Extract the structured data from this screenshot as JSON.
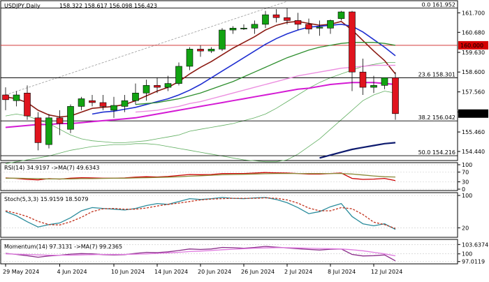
{
  "header": {
    "symbol": "USDJPY,Daily",
    "ohlc": "158.322 158.617 156.098 156.423"
  },
  "colors": {
    "bull": "#12a312",
    "bear": "#e0141e",
    "ma_darkred": "#8b1a12",
    "ma_blue": "#1f2fd1",
    "ma_green": "#2f8f2f",
    "ma_pink": "#ec8fe0",
    "ma_magenta": "#d41ad4",
    "ma_navy": "#0d1a6e",
    "band": "#5fae5f",
    "hline_red": "#cc1f1f",
    "price_tag_bg": "#000000",
    "round_tag_bg": "#d40000"
  },
  "chart_data": [
    {
      "type": "candlestick",
      "title": "USDJPY,Daily",
      "ylim": [
        154.0,
        162.3
      ],
      "y_ticks": [
        161.7,
        160.68,
        159.63,
        158.6,
        157.56,
        156.51,
        155.46,
        154.44
      ],
      "y_tick_labels": [
        "161.700",
        "160.680",
        "159.630",
        "158.600",
        "157.560",
        "156.510",
        "155.460",
        "154.440"
      ],
      "x_labels": [
        "29 May 2024",
        "4 Jun 2024",
        "10 Jun 2024",
        "14 Jun 2024",
        "20 Jun 2024",
        "26 Jun 2024",
        "2 Jul 2024",
        "8 Jul 2024",
        "12 Jul 2024"
      ],
      "x_label_index": [
        0,
        5,
        10,
        14,
        18,
        22,
        26,
        30,
        34
      ],
      "candles": [
        {
          "o": 157.4,
          "h": 157.8,
          "l": 156.6,
          "c": 157.15
        },
        {
          "o": 157.1,
          "h": 157.6,
          "l": 156.8,
          "c": 157.4
        },
        {
          "o": 157.5,
          "h": 157.9,
          "l": 156.1,
          "c": 156.3
        },
        {
          "o": 156.2,
          "h": 156.5,
          "l": 154.5,
          "c": 154.9
        },
        {
          "o": 154.8,
          "h": 156.4,
          "l": 154.6,
          "c": 156.2
        },
        {
          "o": 156.2,
          "h": 156.6,
          "l": 155.3,
          "c": 155.9
        },
        {
          "o": 155.6,
          "h": 156.9,
          "l": 155.4,
          "c": 156.8
        },
        {
          "o": 156.8,
          "h": 157.3,
          "l": 156.6,
          "c": 157.2
        },
        {
          "o": 157.1,
          "h": 157.4,
          "l": 156.8,
          "c": 157.0
        },
        {
          "o": 157.0,
          "h": 157.4,
          "l": 156.6,
          "c": 156.8
        },
        {
          "o": 156.6,
          "h": 157.3,
          "l": 156.2,
          "c": 156.85
        },
        {
          "o": 156.8,
          "h": 157.4,
          "l": 156.5,
          "c": 157.1
        },
        {
          "o": 157.1,
          "h": 158.0,
          "l": 156.9,
          "c": 157.5
        },
        {
          "o": 157.5,
          "h": 158.2,
          "l": 157.1,
          "c": 157.9
        },
        {
          "o": 157.9,
          "h": 158.3,
          "l": 157.5,
          "c": 157.8
        },
        {
          "o": 157.8,
          "h": 158.4,
          "l": 157.6,
          "c": 158.0
        },
        {
          "o": 158.0,
          "h": 159.1,
          "l": 157.9,
          "c": 158.9
        },
        {
          "o": 158.9,
          "h": 159.9,
          "l": 158.7,
          "c": 159.8
        },
        {
          "o": 159.8,
          "h": 160.0,
          "l": 159.4,
          "c": 159.7
        },
        {
          "o": 159.7,
          "h": 159.9,
          "l": 159.6,
          "c": 159.8
        },
        {
          "o": 159.8,
          "h": 160.9,
          "l": 159.7,
          "c": 160.8
        },
        {
          "o": 160.8,
          "h": 161.0,
          "l": 160.6,
          "c": 160.9
        },
        {
          "o": 160.9,
          "h": 161.1,
          "l": 160.8,
          "c": 160.9
        },
        {
          "o": 160.9,
          "h": 161.3,
          "l": 160.6,
          "c": 161.1
        },
        {
          "o": 161.1,
          "h": 161.8,
          "l": 160.9,
          "c": 161.6
        },
        {
          "o": 161.6,
          "h": 161.9,
          "l": 161.2,
          "c": 161.45
        },
        {
          "o": 161.45,
          "h": 161.95,
          "l": 161.1,
          "c": 161.3
        },
        {
          "o": 161.3,
          "h": 161.7,
          "l": 160.8,
          "c": 161.1
        },
        {
          "o": 161.1,
          "h": 161.4,
          "l": 160.6,
          "c": 160.85
        },
        {
          "o": 160.9,
          "h": 161.3,
          "l": 160.5,
          "c": 160.95
        },
        {
          "o": 160.9,
          "h": 161.35,
          "l": 160.6,
          "c": 161.3
        },
        {
          "o": 161.4,
          "h": 161.8,
          "l": 161.3,
          "c": 161.75
        },
        {
          "o": 161.75,
          "h": 161.8,
          "l": 157.6,
          "c": 158.6
        },
        {
          "o": 158.6,
          "h": 159.3,
          "l": 157.4,
          "c": 157.8
        },
        {
          "o": 157.8,
          "h": 158.4,
          "l": 157.5,
          "c": 157.9
        },
        {
          "o": 157.9,
          "h": 158.3,
          "l": 157.7,
          "c": 158.3
        },
        {
          "o": 158.3,
          "h": 158.6,
          "l": 156.1,
          "c": 156.42
        }
      ],
      "moving_averages": [
        {
          "color": "ma_darkred",
          "values": [
            157.3,
            157.2,
            157.0,
            156.6,
            156.35,
            156.25,
            156.3,
            156.5,
            156.7,
            156.75,
            156.8,
            156.9,
            157.1,
            157.35,
            157.6,
            157.8,
            158.1,
            158.5,
            158.85,
            159.15,
            159.5,
            159.85,
            160.15,
            160.45,
            160.8,
            161.05,
            161.2,
            161.25,
            161.15,
            161.05,
            161.1,
            161.25,
            160.8,
            160.25,
            159.7,
            159.2,
            158.5
          ]
        },
        {
          "color": "ma_blue",
          "values": [
            null,
            null,
            null,
            null,
            null,
            null,
            null,
            null,
            156.4,
            156.5,
            156.55,
            156.65,
            156.75,
            156.9,
            157.05,
            157.2,
            157.4,
            157.65,
            157.95,
            158.3,
            158.65,
            159.0,
            159.35,
            159.7,
            160.05,
            160.35,
            160.6,
            160.8,
            160.95,
            161.0,
            161.05,
            161.1,
            161.0,
            160.7,
            160.3,
            159.9,
            159.45
          ]
        },
        {
          "color": "ma_green",
          "values": [
            null,
            null,
            null,
            null,
            null,
            null,
            null,
            null,
            null,
            null,
            null,
            null,
            156.9,
            156.95,
            157.0,
            157.1,
            157.2,
            157.35,
            157.5,
            157.7,
            157.9,
            158.1,
            158.35,
            158.6,
            158.85,
            159.1,
            159.35,
            159.55,
            159.75,
            159.9,
            160.0,
            160.1,
            160.15,
            160.15,
            160.15,
            160.1,
            160.0
          ]
        },
        {
          "color": "ma_pink",
          "values": [
            null,
            null,
            null,
            null,
            null,
            null,
            null,
            null,
            null,
            null,
            null,
            null,
            156.5,
            156.55,
            156.6,
            156.7,
            156.8,
            156.95,
            157.05,
            157.2,
            157.35,
            157.5,
            157.65,
            157.8,
            157.95,
            158.1,
            158.25,
            158.4,
            158.5,
            158.6,
            158.7,
            158.8,
            158.85,
            158.9,
            158.95,
            158.95,
            158.95
          ]
        },
        {
          "color": "ma_magenta",
          "values": [
            155.7,
            155.75,
            155.8,
            155.85,
            155.85,
            155.9,
            155.9,
            155.95,
            156.0,
            156.05,
            156.1,
            156.15,
            156.2,
            156.3,
            156.4,
            156.5,
            156.6,
            156.7,
            156.8,
            156.9,
            157.0,
            157.1,
            157.2,
            157.3,
            157.4,
            157.5,
            157.6,
            157.7,
            157.75,
            157.85,
            157.95,
            158.0,
            158.05,
            158.05,
            158.05,
            158.0,
            157.95
          ]
        },
        {
          "color": "ma_navy",
          "values": [
            null,
            null,
            null,
            null,
            null,
            null,
            null,
            null,
            null,
            null,
            null,
            null,
            null,
            null,
            null,
            null,
            null,
            null,
            null,
            null,
            null,
            null,
            null,
            null,
            null,
            null,
            null,
            null,
            null,
            154.1,
            154.25,
            154.4,
            154.55,
            154.65,
            154.75,
            154.85,
            154.9
          ]
        }
      ],
      "bands": [
        {
          "color": "band",
          "values": [
            156.3,
            156.4,
            156.3,
            156.1,
            155.9,
            155.6,
            155.3,
            155.1,
            155.0,
            154.95,
            154.9,
            154.9,
            154.95,
            155.0,
            155.1,
            155.2,
            155.3,
            155.5,
            155.6,
            155.7,
            155.8,
            155.9,
            156.05,
            156.2,
            156.4,
            156.7,
            157.05,
            157.4,
            157.75,
            158.05,
            158.3,
            158.5,
            158.7,
            158.9,
            159.0,
            159.1,
            159.1
          ]
        },
        {
          "color": "band",
          "values": [
            153.8,
            153.9,
            154.0,
            154.1,
            154.2,
            154.35,
            154.5,
            154.6,
            154.7,
            154.75,
            154.8,
            154.8,
            154.85,
            154.85,
            154.8,
            154.7,
            154.6,
            154.5,
            154.4,
            154.3,
            154.2,
            154.1,
            154.0,
            153.95,
            153.9,
            153.9,
            154.0,
            154.3,
            154.7,
            155.1,
            155.6,
            156.1,
            156.6,
            157.1,
            157.4,
            157.6,
            157.5
          ]
        }
      ],
      "horizontal_lines": [
        {
          "value": 161.952,
          "label": "0.0 161.952",
          "color": "#000000"
        },
        {
          "value": 160.0,
          "label": "",
          "color": "hline_red"
        },
        {
          "value": 158.301,
          "label": "23.6 158.301",
          "color": "#000000"
        },
        {
          "value": 156.042,
          "label": "38.2 156.042",
          "color": "#000000"
        },
        {
          "value": 154.216,
          "label": "50.0 154.216",
          "color": "#000000"
        }
      ],
      "axis_tags": [
        {
          "value": 160.0,
          "label": "160.000",
          "bg": "round_tag_bg"
        },
        {
          "value": 156.423,
          "label": "156.423",
          "bg": "price_tag_bg"
        }
      ],
      "trendline": {
        "from": [
          0,
          157.4
        ],
        "to": [
          26,
          162.3
        ]
      }
    },
    {
      "type": "line",
      "title": "RSI(14) 34.9197 ->MA(7) 49.6343",
      "ylim": [
        0,
        100
      ],
      "y_ticks": [
        100,
        70,
        30,
        0
      ],
      "y_tick_labels": [
        "100",
        "70",
        "30",
        "0"
      ],
      "series": [
        {
          "color": "#cc0000",
          "values": [
            46,
            44,
            40,
            38,
            43,
            41,
            45,
            47,
            46,
            45,
            45,
            46,
            49,
            51,
            50,
            52,
            56,
            60,
            59,
            60,
            64,
            64,
            64,
            66,
            68,
            67,
            66,
            64,
            62,
            62,
            64,
            66,
            44,
            40,
            41,
            44,
            35
          ]
        },
        {
          "color": "#8a8a3a",
          "values": [
            45,
            45,
            44,
            43,
            42,
            42,
            42,
            43,
            43,
            44,
            45,
            45,
            46,
            47,
            48,
            49,
            51,
            53,
            55,
            57,
            59,
            60,
            61,
            62,
            63,
            64,
            64,
            64,
            64,
            64,
            64,
            64,
            62,
            58,
            54,
            51,
            49.6
          ]
        }
      ]
    },
    {
      "type": "line",
      "title": "Stoch(5,3,3) 15.9159 18.5079",
      "ylim": [
        0,
        100
      ],
      "y_ticks": [
        100,
        20
      ],
      "y_tick_labels": [
        "100",
        "20"
      ],
      "series": [
        {
          "color": "#2a8c9c",
          "values": [
            60,
            50,
            35,
            22,
            28,
            32,
            45,
            62,
            70,
            68,
            66,
            64,
            68,
            75,
            80,
            78,
            85,
            92,
            90,
            92,
            95,
            93,
            92,
            94,
            95,
            90,
            82,
            70,
            55,
            60,
            72,
            80,
            48,
            30,
            25,
            30,
            16
          ]
        },
        {
          "color": "#c0301a",
          "values": [
            62,
            56,
            48,
            36,
            28,
            27,
            35,
            46,
            60,
            67,
            68,
            66,
            66,
            69,
            74,
            78,
            81,
            85,
            89,
            91,
            92,
            93,
            93,
            93,
            94,
            93,
            89,
            81,
            69,
            62,
            62,
            70,
            67,
            53,
            34,
            28,
            18.5
          ]
        }
      ]
    },
    {
      "type": "line",
      "title": "Momentum(14) 97.3131 ->MA(7) 99.2365",
      "ylim": [
        96.4,
        104.8
      ],
      "y_ticks": [
        103.6374,
        100,
        97.0119
      ],
      "y_tick_labels": [
        "103.6374",
        "100",
        "97.0119"
      ],
      "series": [
        {
          "color": "#8a2d8a",
          "values": [
            100.2,
            99.8,
            99.3,
            98.7,
            99.2,
            99.5,
            99.9,
            100.1,
            100.0,
            99.7,
            99.6,
            99.7,
            100.2,
            100.6,
            100.5,
            100.8,
            101.3,
            101.9,
            101.7,
            101.9,
            102.5,
            102.4,
            102.2,
            102.5,
            102.9,
            102.6,
            102.3,
            102.0,
            101.7,
            101.5,
            101.8,
            101.9,
            99.8,
            99.2,
            99.3,
            99.6,
            97.3
          ]
        },
        {
          "color": "#e07ae0",
          "values": [
            100.0,
            99.9,
            99.8,
            99.6,
            99.5,
            99.5,
            99.5,
            99.6,
            99.7,
            99.8,
            99.8,
            99.8,
            99.9,
            100.0,
            100.2,
            100.4,
            100.6,
            100.9,
            101.1,
            101.3,
            101.6,
            101.8,
            102.0,
            102.2,
            102.3,
            102.4,
            102.4,
            102.3,
            102.2,
            102.1,
            102.0,
            101.9,
            101.6,
            101.2,
            100.6,
            100.0,
            99.24
          ]
        }
      ]
    }
  ]
}
